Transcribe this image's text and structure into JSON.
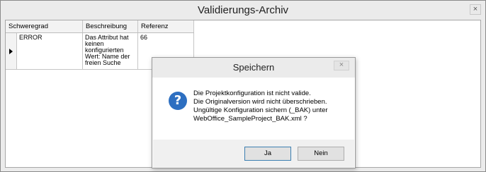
{
  "window": {
    "title": "Validierungs-Archiv",
    "close_glyph": "×"
  },
  "grid": {
    "columns": [
      "Schweregrad",
      "Beschreibung",
      "Referenz"
    ],
    "rows": [
      {
        "severity": "ERROR",
        "description": "Das Attribut hat keinen konfigurierten Wert: Name der freien Suche",
        "reference": "66"
      }
    ]
  },
  "dialog": {
    "title": "Speichern",
    "close_glyph": "×",
    "icon": "question-icon",
    "icon_glyph": "?",
    "message_lines": [
      "Die Projektkonfiguration ist nicht valide.",
      "Die Originalversion wird nicht überschrieben.",
      "Ungültige Konfiguration sichern (_BAK) unter",
      "WebOffice_SampleProject_BAK.xml ?"
    ],
    "buttons": {
      "yes": "Ja",
      "no": "Nein"
    }
  },
  "colors": {
    "icon_blue": "#2d6fc1",
    "default_button_border": "#3c7fb1"
  }
}
